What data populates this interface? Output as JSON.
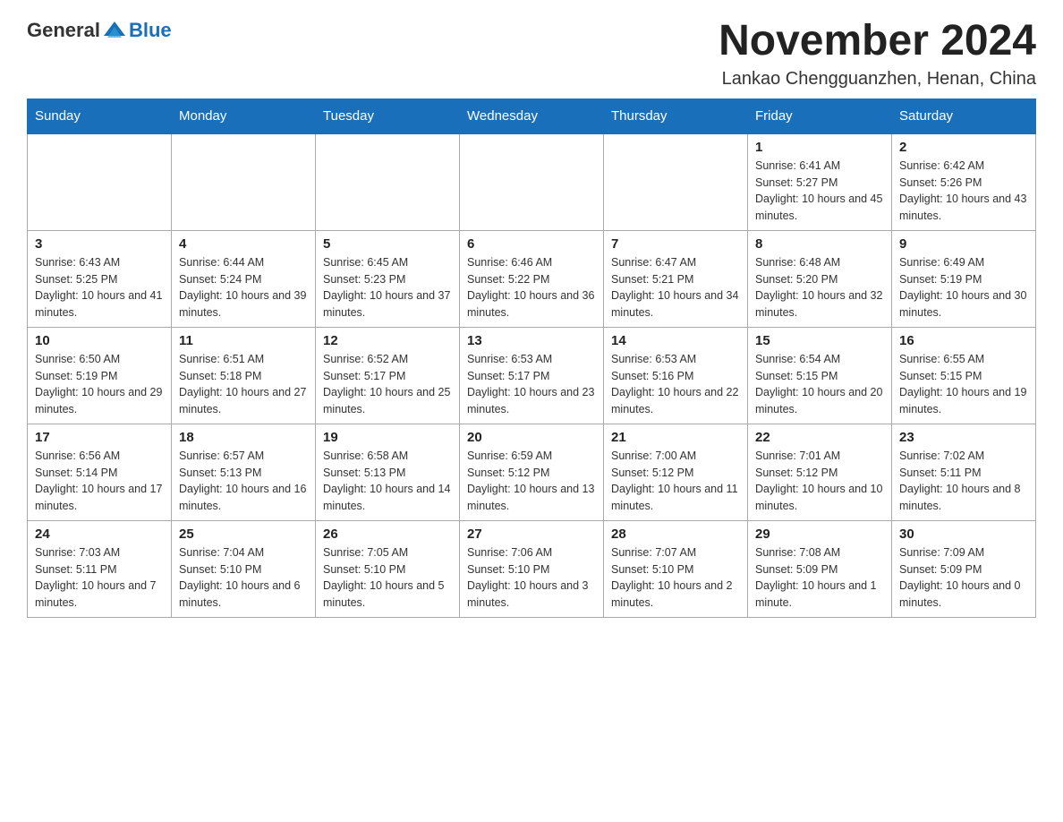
{
  "logo": {
    "text_general": "General",
    "text_blue": "Blue"
  },
  "header": {
    "title": "November 2024",
    "subtitle": "Lankao Chengguanzhen, Henan, China"
  },
  "days_of_week": [
    "Sunday",
    "Monday",
    "Tuesday",
    "Wednesday",
    "Thursday",
    "Friday",
    "Saturday"
  ],
  "weeks": [
    [
      {
        "day": "",
        "info": ""
      },
      {
        "day": "",
        "info": ""
      },
      {
        "day": "",
        "info": ""
      },
      {
        "day": "",
        "info": ""
      },
      {
        "day": "",
        "info": ""
      },
      {
        "day": "1",
        "info": "Sunrise: 6:41 AM\nSunset: 5:27 PM\nDaylight: 10 hours and 45 minutes."
      },
      {
        "day": "2",
        "info": "Sunrise: 6:42 AM\nSunset: 5:26 PM\nDaylight: 10 hours and 43 minutes."
      }
    ],
    [
      {
        "day": "3",
        "info": "Sunrise: 6:43 AM\nSunset: 5:25 PM\nDaylight: 10 hours and 41 minutes."
      },
      {
        "day": "4",
        "info": "Sunrise: 6:44 AM\nSunset: 5:24 PM\nDaylight: 10 hours and 39 minutes."
      },
      {
        "day": "5",
        "info": "Sunrise: 6:45 AM\nSunset: 5:23 PM\nDaylight: 10 hours and 37 minutes."
      },
      {
        "day": "6",
        "info": "Sunrise: 6:46 AM\nSunset: 5:22 PM\nDaylight: 10 hours and 36 minutes."
      },
      {
        "day": "7",
        "info": "Sunrise: 6:47 AM\nSunset: 5:21 PM\nDaylight: 10 hours and 34 minutes."
      },
      {
        "day": "8",
        "info": "Sunrise: 6:48 AM\nSunset: 5:20 PM\nDaylight: 10 hours and 32 minutes."
      },
      {
        "day": "9",
        "info": "Sunrise: 6:49 AM\nSunset: 5:19 PM\nDaylight: 10 hours and 30 minutes."
      }
    ],
    [
      {
        "day": "10",
        "info": "Sunrise: 6:50 AM\nSunset: 5:19 PM\nDaylight: 10 hours and 29 minutes."
      },
      {
        "day": "11",
        "info": "Sunrise: 6:51 AM\nSunset: 5:18 PM\nDaylight: 10 hours and 27 minutes."
      },
      {
        "day": "12",
        "info": "Sunrise: 6:52 AM\nSunset: 5:17 PM\nDaylight: 10 hours and 25 minutes."
      },
      {
        "day": "13",
        "info": "Sunrise: 6:53 AM\nSunset: 5:17 PM\nDaylight: 10 hours and 23 minutes."
      },
      {
        "day": "14",
        "info": "Sunrise: 6:53 AM\nSunset: 5:16 PM\nDaylight: 10 hours and 22 minutes."
      },
      {
        "day": "15",
        "info": "Sunrise: 6:54 AM\nSunset: 5:15 PM\nDaylight: 10 hours and 20 minutes."
      },
      {
        "day": "16",
        "info": "Sunrise: 6:55 AM\nSunset: 5:15 PM\nDaylight: 10 hours and 19 minutes."
      }
    ],
    [
      {
        "day": "17",
        "info": "Sunrise: 6:56 AM\nSunset: 5:14 PM\nDaylight: 10 hours and 17 minutes."
      },
      {
        "day": "18",
        "info": "Sunrise: 6:57 AM\nSunset: 5:13 PM\nDaylight: 10 hours and 16 minutes."
      },
      {
        "day": "19",
        "info": "Sunrise: 6:58 AM\nSunset: 5:13 PM\nDaylight: 10 hours and 14 minutes."
      },
      {
        "day": "20",
        "info": "Sunrise: 6:59 AM\nSunset: 5:12 PM\nDaylight: 10 hours and 13 minutes."
      },
      {
        "day": "21",
        "info": "Sunrise: 7:00 AM\nSunset: 5:12 PM\nDaylight: 10 hours and 11 minutes."
      },
      {
        "day": "22",
        "info": "Sunrise: 7:01 AM\nSunset: 5:12 PM\nDaylight: 10 hours and 10 minutes."
      },
      {
        "day": "23",
        "info": "Sunrise: 7:02 AM\nSunset: 5:11 PM\nDaylight: 10 hours and 8 minutes."
      }
    ],
    [
      {
        "day": "24",
        "info": "Sunrise: 7:03 AM\nSunset: 5:11 PM\nDaylight: 10 hours and 7 minutes."
      },
      {
        "day": "25",
        "info": "Sunrise: 7:04 AM\nSunset: 5:10 PM\nDaylight: 10 hours and 6 minutes."
      },
      {
        "day": "26",
        "info": "Sunrise: 7:05 AM\nSunset: 5:10 PM\nDaylight: 10 hours and 5 minutes."
      },
      {
        "day": "27",
        "info": "Sunrise: 7:06 AM\nSunset: 5:10 PM\nDaylight: 10 hours and 3 minutes."
      },
      {
        "day": "28",
        "info": "Sunrise: 7:07 AM\nSunset: 5:10 PM\nDaylight: 10 hours and 2 minutes."
      },
      {
        "day": "29",
        "info": "Sunrise: 7:08 AM\nSunset: 5:09 PM\nDaylight: 10 hours and 1 minute."
      },
      {
        "day": "30",
        "info": "Sunrise: 7:09 AM\nSunset: 5:09 PM\nDaylight: 10 hours and 0 minutes."
      }
    ]
  ]
}
